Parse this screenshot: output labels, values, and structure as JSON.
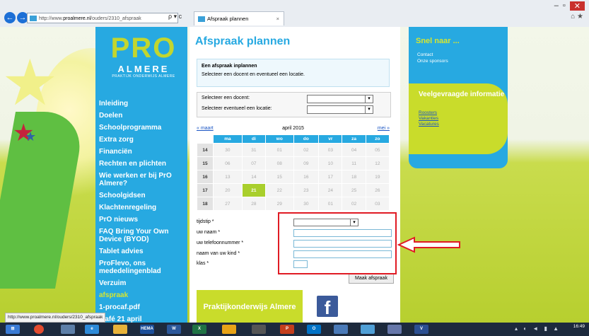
{
  "browser": {
    "url_prefix": "http://www.",
    "url_host": "proalmere.nl",
    "url_path": "/ouders/2310_afspraak",
    "address_tools": "ρ ▾ c",
    "tab_title": "Afspraak plannen",
    "tab_close": "×"
  },
  "logo": {
    "text": "PRO",
    "city": "ALMERE",
    "tagline": "PRAKTIJK ONDERWIJS ALMERE"
  },
  "nav": {
    "items": [
      "Inleiding",
      "Doelen",
      "Schoolprogramma",
      "Extra zorg",
      "Financiën",
      "Rechten en plichten",
      "Wie werken er bij PrO Almere?",
      "Schoolgidsen",
      "Klachtenregeling",
      "PrO nieuws",
      "FAQ Bring Your Own Device (BYOD)",
      "Tablet advies",
      "ProFlevo, ons mededelingenblad",
      "Verzuim",
      "afspraak",
      "1-procaf.pdf",
      "...afé 21 april"
    ],
    "active_index": 14
  },
  "main": {
    "title": "Afspraak plannen",
    "info_heading": "Een afspraak inplannen",
    "info_text": "Selecteer een docent en eventueel een locatie.",
    "select_docent_label": "Selecteer een docent:",
    "select_locatie_label": "Selecteer eventueel een locatie:"
  },
  "calendar": {
    "prev_label": "« maart",
    "month_label": "april 2015",
    "next_label": "mei »",
    "day_headers": [
      "ma",
      "di",
      "wo",
      "do",
      "vr",
      "za",
      "zo"
    ],
    "weeks": [
      {
        "week": "14",
        "days": [
          "30",
          "31",
          "01",
          "02",
          "03",
          "04",
          "05"
        ]
      },
      {
        "week": "15",
        "days": [
          "06",
          "07",
          "08",
          "09",
          "10",
          "11",
          "12"
        ]
      },
      {
        "week": "16",
        "days": [
          "13",
          "14",
          "15",
          "16",
          "17",
          "18",
          "19"
        ]
      },
      {
        "week": "17",
        "days": [
          "20",
          "21",
          "22",
          "23",
          "24",
          "25",
          "26"
        ]
      },
      {
        "week": "18",
        "days": [
          "27",
          "28",
          "29",
          "30",
          "01",
          "02",
          "03"
        ]
      }
    ],
    "today": "21"
  },
  "form": {
    "tijdstip_label": "tijdstip *",
    "naam_label": "uw naam *",
    "telefoon_label": "uw telefoonnummer *",
    "kind_label": "naam van uw kind *",
    "klas_label": "klas *",
    "submit_label": "Maak afspraak"
  },
  "sidebar": {
    "snel_title": "Snel naar ...",
    "snel_links": [
      "Contact",
      "Onze sponsors"
    ],
    "faq_title": "Veelgevraagde informatie",
    "faq_links": [
      "Roosters",
      "Vakanties",
      "Vacatures"
    ]
  },
  "promo": {
    "text": "Praktijkonderwijs Almere",
    "facebook_glyph": "f"
  },
  "status_url": "http://www.proalmere.nl/ouders/2310_afspraak",
  "taskbar": {
    "time": "16:49",
    "items": [
      "",
      "",
      "",
      "",
      "HEMA",
      "W",
      "X",
      "",
      "",
      "P",
      "O",
      "",
      "",
      "",
      "V"
    ]
  },
  "colors": {
    "brand_blue": "#27a9e1",
    "brand_green": "#c9dc2b",
    "highlight_red": "#e01b24"
  }
}
